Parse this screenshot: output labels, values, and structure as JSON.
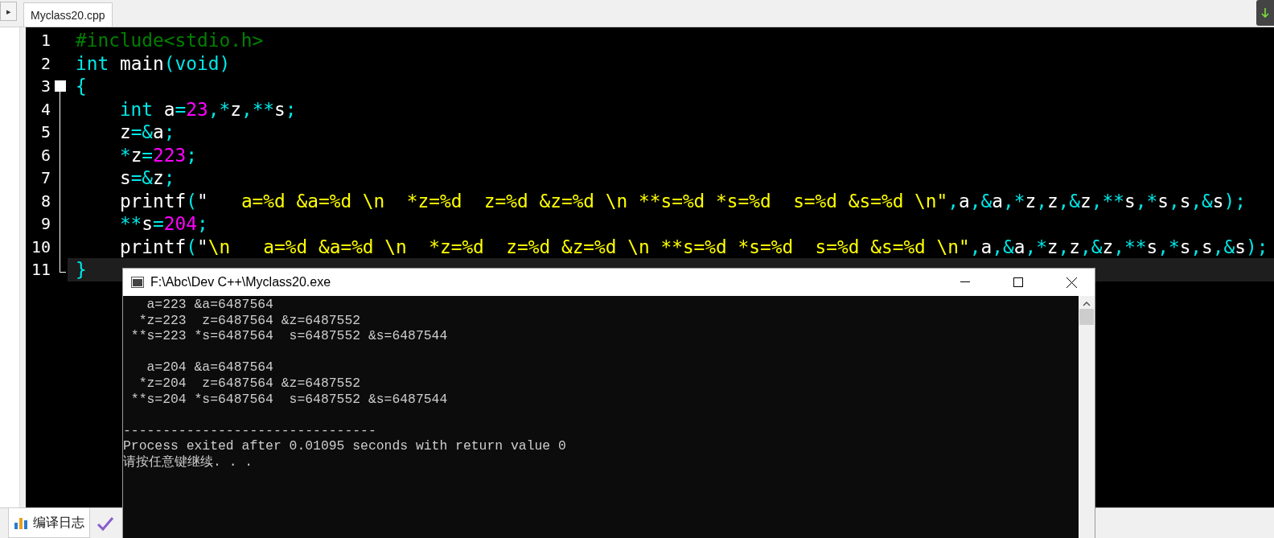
{
  "side_button": {
    "label": "▸"
  },
  "editor_tab": {
    "label": "Myclass20.cpp",
    "selected": true
  },
  "code_lines": [
    {
      "number": "1",
      "fold_marker": false,
      "in_fold": false,
      "fold_end": false,
      "current": false,
      "tokens": [
        {
          "kind": "preprocessor",
          "text": "#include<stdio.h>"
        }
      ]
    },
    {
      "number": "2",
      "fold_marker": false,
      "in_fold": false,
      "fold_end": false,
      "current": false,
      "tokens": [
        {
          "kind": "keyword",
          "text": "int"
        },
        {
          "kind": "plain",
          "text": " main"
        },
        {
          "kind": "symbol",
          "text": "("
        },
        {
          "kind": "keyword",
          "text": "void"
        },
        {
          "kind": "symbol",
          "text": ")"
        }
      ]
    },
    {
      "number": "3",
      "fold_marker": true,
      "in_fold": false,
      "fold_end": false,
      "current": false,
      "tokens": [
        {
          "kind": "symbol",
          "text": "{"
        }
      ]
    },
    {
      "number": "4",
      "fold_marker": false,
      "in_fold": true,
      "fold_end": false,
      "current": false,
      "tokens": [
        {
          "kind": "keyword",
          "text": "    int"
        },
        {
          "kind": "plain",
          "text": " a"
        },
        {
          "kind": "symbol",
          "text": "="
        },
        {
          "kind": "number",
          "text": "23"
        },
        {
          "kind": "symbol",
          "text": ",*"
        },
        {
          "kind": "plain",
          "text": "z"
        },
        {
          "kind": "symbol",
          "text": ",**"
        },
        {
          "kind": "plain",
          "text": "s"
        },
        {
          "kind": "symbol",
          "text": ";"
        }
      ]
    },
    {
      "number": "5",
      "fold_marker": false,
      "in_fold": true,
      "fold_end": false,
      "current": false,
      "tokens": [
        {
          "kind": "plain",
          "text": "    z"
        },
        {
          "kind": "symbol",
          "text": "=&"
        },
        {
          "kind": "plain",
          "text": "a"
        },
        {
          "kind": "symbol",
          "text": ";"
        }
      ]
    },
    {
      "number": "6",
      "fold_marker": false,
      "in_fold": true,
      "fold_end": false,
      "current": false,
      "tokens": [
        {
          "kind": "symbol",
          "text": "    *"
        },
        {
          "kind": "plain",
          "text": "z"
        },
        {
          "kind": "symbol",
          "text": "="
        },
        {
          "kind": "number",
          "text": "223"
        },
        {
          "kind": "symbol",
          "text": ";"
        }
      ]
    },
    {
      "number": "7",
      "fold_marker": false,
      "in_fold": true,
      "fold_end": false,
      "current": false,
      "tokens": [
        {
          "kind": "plain",
          "text": "    s"
        },
        {
          "kind": "symbol",
          "text": "=&"
        },
        {
          "kind": "plain",
          "text": "z"
        },
        {
          "kind": "symbol",
          "text": ";"
        }
      ]
    },
    {
      "number": "8",
      "fold_marker": false,
      "in_fold": true,
      "fold_end": false,
      "current": false,
      "tokens": [
        {
          "kind": "plain",
          "text": "    printf"
        },
        {
          "kind": "symbol",
          "text": "("
        },
        {
          "kind": "plain",
          "text": "\""
        },
        {
          "kind": "string",
          "text": "   a=%d &a=%d \\n  *z=%d  z=%d &z=%d \\n **s=%d *s=%d  s=%d &s=%d \\n\""
        },
        {
          "kind": "symbol",
          "text": ","
        },
        {
          "kind": "plain",
          "text": "a"
        },
        {
          "kind": "symbol",
          "text": ",&"
        },
        {
          "kind": "plain",
          "text": "a"
        },
        {
          "kind": "symbol",
          "text": ",*"
        },
        {
          "kind": "plain",
          "text": "z"
        },
        {
          "kind": "symbol",
          "text": ","
        },
        {
          "kind": "plain",
          "text": "z"
        },
        {
          "kind": "symbol",
          "text": ",&"
        },
        {
          "kind": "plain",
          "text": "z"
        },
        {
          "kind": "symbol",
          "text": ",**"
        },
        {
          "kind": "plain",
          "text": "s"
        },
        {
          "kind": "symbol",
          "text": ",*"
        },
        {
          "kind": "plain",
          "text": "s"
        },
        {
          "kind": "symbol",
          "text": ","
        },
        {
          "kind": "plain",
          "text": "s"
        },
        {
          "kind": "symbol",
          "text": ",&"
        },
        {
          "kind": "plain",
          "text": "s"
        },
        {
          "kind": "symbol",
          "text": ");"
        }
      ]
    },
    {
      "number": "9",
      "fold_marker": false,
      "in_fold": true,
      "fold_end": false,
      "current": false,
      "tokens": [
        {
          "kind": "symbol",
          "text": "    **"
        },
        {
          "kind": "plain",
          "text": "s"
        },
        {
          "kind": "symbol",
          "text": "="
        },
        {
          "kind": "number",
          "text": "204"
        },
        {
          "kind": "symbol",
          "text": ";"
        }
      ]
    },
    {
      "number": "10",
      "fold_marker": false,
      "in_fold": true,
      "fold_end": false,
      "current": false,
      "tokens": [
        {
          "kind": "plain",
          "text": "    printf"
        },
        {
          "kind": "symbol",
          "text": "("
        },
        {
          "kind": "plain",
          "text": "\""
        },
        {
          "kind": "string",
          "text": "\\n   a=%d &a=%d \\n  *z=%d  z=%d &z=%d \\n **s=%d *s=%d  s=%d &s=%d \\n\""
        },
        {
          "kind": "symbol",
          "text": ","
        },
        {
          "kind": "plain",
          "text": "a"
        },
        {
          "kind": "symbol",
          "text": ",&"
        },
        {
          "kind": "plain",
          "text": "a"
        },
        {
          "kind": "symbol",
          "text": ",*"
        },
        {
          "kind": "plain",
          "text": "z"
        },
        {
          "kind": "symbol",
          "text": ","
        },
        {
          "kind": "plain",
          "text": "z"
        },
        {
          "kind": "symbol",
          "text": ",&"
        },
        {
          "kind": "plain",
          "text": "z"
        },
        {
          "kind": "symbol",
          "text": ",**"
        },
        {
          "kind": "plain",
          "text": "s"
        },
        {
          "kind": "symbol",
          "text": ",*"
        },
        {
          "kind": "plain",
          "text": "s"
        },
        {
          "kind": "symbol",
          "text": ","
        },
        {
          "kind": "plain",
          "text": "s"
        },
        {
          "kind": "symbol",
          "text": ",&"
        },
        {
          "kind": "plain",
          "text": "s"
        },
        {
          "kind": "symbol",
          "text": ");"
        }
      ]
    },
    {
      "number": "11",
      "fold_marker": false,
      "in_fold": true,
      "fold_end": true,
      "current": true,
      "tokens": [
        {
          "kind": "symbol",
          "text": "}"
        }
      ]
    }
  ],
  "console": {
    "title": "F:\\Abc\\Dev C++\\Myclass20.exe",
    "blocks": [
      [
        "   a=223 &a=6487564",
        "  *z=223  z=6487564 &z=6487552",
        " **s=223 *s=6487564  s=6487552 &s=6487544"
      ],
      [
        "   a=204 &a=6487564",
        "  *z=204  z=6487564 &z=6487552",
        " **s=204 *s=6487564  s=6487552 &s=6487544"
      ],
      [
        "--------------------------------",
        "Process exited after 0.01095 seconds with return value 0",
        "请按任意键继续. . ."
      ]
    ]
  },
  "log_tab": {
    "label": "编译日志",
    "selected": true
  }
}
